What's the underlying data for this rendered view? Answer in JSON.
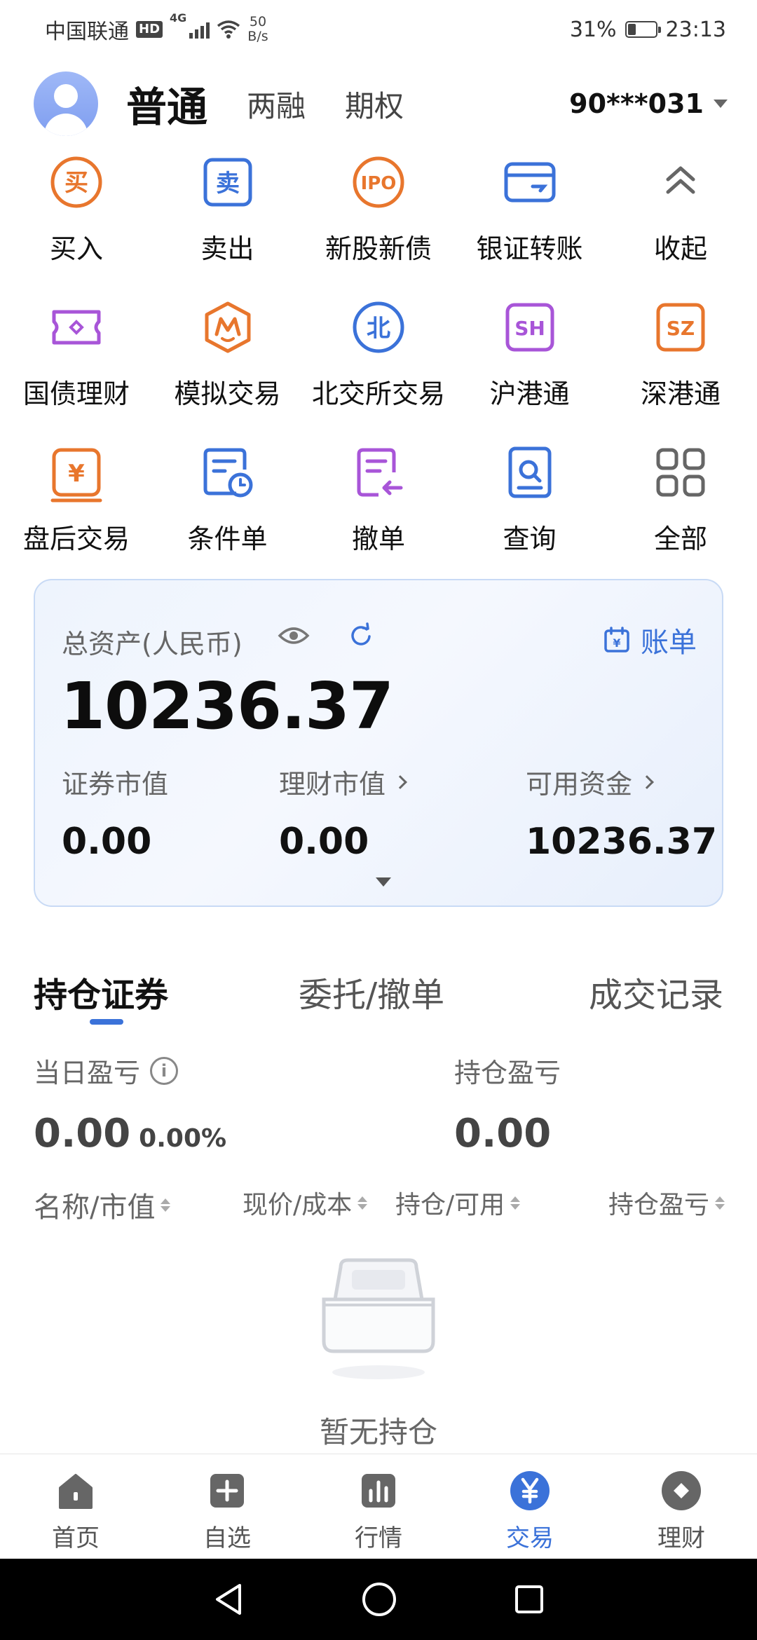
{
  "status_bar": {
    "carrier": "中国联通",
    "hd": "HD",
    "network": "4G",
    "speed_value": "50",
    "speed_unit": "B/s",
    "battery": "31%",
    "battery_level": 0.31,
    "time": "23:13"
  },
  "header": {
    "tabs": [
      "普通",
      "两融",
      "期权"
    ],
    "account": "90***031"
  },
  "quick_actions": [
    {
      "label": "买入",
      "icon": "buy-icon",
      "glyph": "买",
      "color": "#e8762d"
    },
    {
      "label": "卖出",
      "icon": "sell-icon",
      "glyph": "卖",
      "color": "#3b72d9"
    },
    {
      "label": "新股新债",
      "icon": "ipo-icon",
      "glyph": "IPO",
      "color": "#e8762d"
    },
    {
      "label": "银证转账",
      "icon": "bank-card-icon",
      "glyph": "",
      "color": "#3b72d9"
    },
    {
      "label": "收起",
      "icon": "collapse-icon",
      "glyph": "",
      "color": "#666666"
    },
    {
      "label": "国债理财",
      "icon": "treasury-ticket-icon",
      "glyph": "",
      "color": "#a855d8"
    },
    {
      "label": "模拟交易",
      "icon": "simulation-icon",
      "glyph": "",
      "color": "#e8762d"
    },
    {
      "label": "北交所交易",
      "icon": "bse-icon",
      "glyph": "北",
      "color": "#3b72d9"
    },
    {
      "label": "沪港通",
      "icon": "sh-connect-icon",
      "glyph": "SH",
      "color": "#a855d8"
    },
    {
      "label": "深港通",
      "icon": "sz-connect-icon",
      "glyph": "SZ",
      "color": "#e8762d"
    },
    {
      "label": "盘后交易",
      "icon": "after-hours-icon",
      "glyph": "¥",
      "color": "#e8762d"
    },
    {
      "label": "条件单",
      "icon": "conditional-order-icon",
      "glyph": "",
      "color": "#3b72d9"
    },
    {
      "label": "撤单",
      "icon": "cancel-order-icon",
      "glyph": "",
      "color": "#a855d8"
    },
    {
      "label": "查询",
      "icon": "query-icon",
      "glyph": "",
      "color": "#3b72d9"
    },
    {
      "label": "全部",
      "icon": "all-apps-icon",
      "glyph": "",
      "color": "#666666"
    }
  ],
  "asset_card": {
    "label": "总资产(人民币)",
    "bill_label": "账单",
    "total": "10236.37",
    "securities_label": "证券市值",
    "securities_value": "0.00",
    "wealth_label": "理财市值",
    "wealth_value": "0.00",
    "available_label": "可用资金",
    "available_value": "10236.37"
  },
  "position_tabs": [
    "持仓证券",
    "委托/撤单",
    "成交记录"
  ],
  "pnl": {
    "daily_label": "当日盈亏",
    "daily_value": "0.00",
    "daily_pct": "0.00%",
    "holding_label": "持仓盈亏",
    "holding_value": "0.00"
  },
  "columns": [
    "名称/市值",
    "现价/成本",
    "持仓/可用",
    "持仓盈亏"
  ],
  "empty_text": "暂无持仓",
  "bottom_nav": [
    {
      "label": "首页",
      "icon": "home-icon"
    },
    {
      "label": "自选",
      "icon": "watchlist-add-icon"
    },
    {
      "label": "行情",
      "icon": "market-chart-icon"
    },
    {
      "label": "交易",
      "icon": "trade-yen-icon",
      "active": true
    },
    {
      "label": "理财",
      "icon": "wealth-diamond-icon"
    }
  ],
  "colors": {
    "accent": "#3b72d9",
    "orange": "#e8762d",
    "purple": "#a855d8"
  }
}
